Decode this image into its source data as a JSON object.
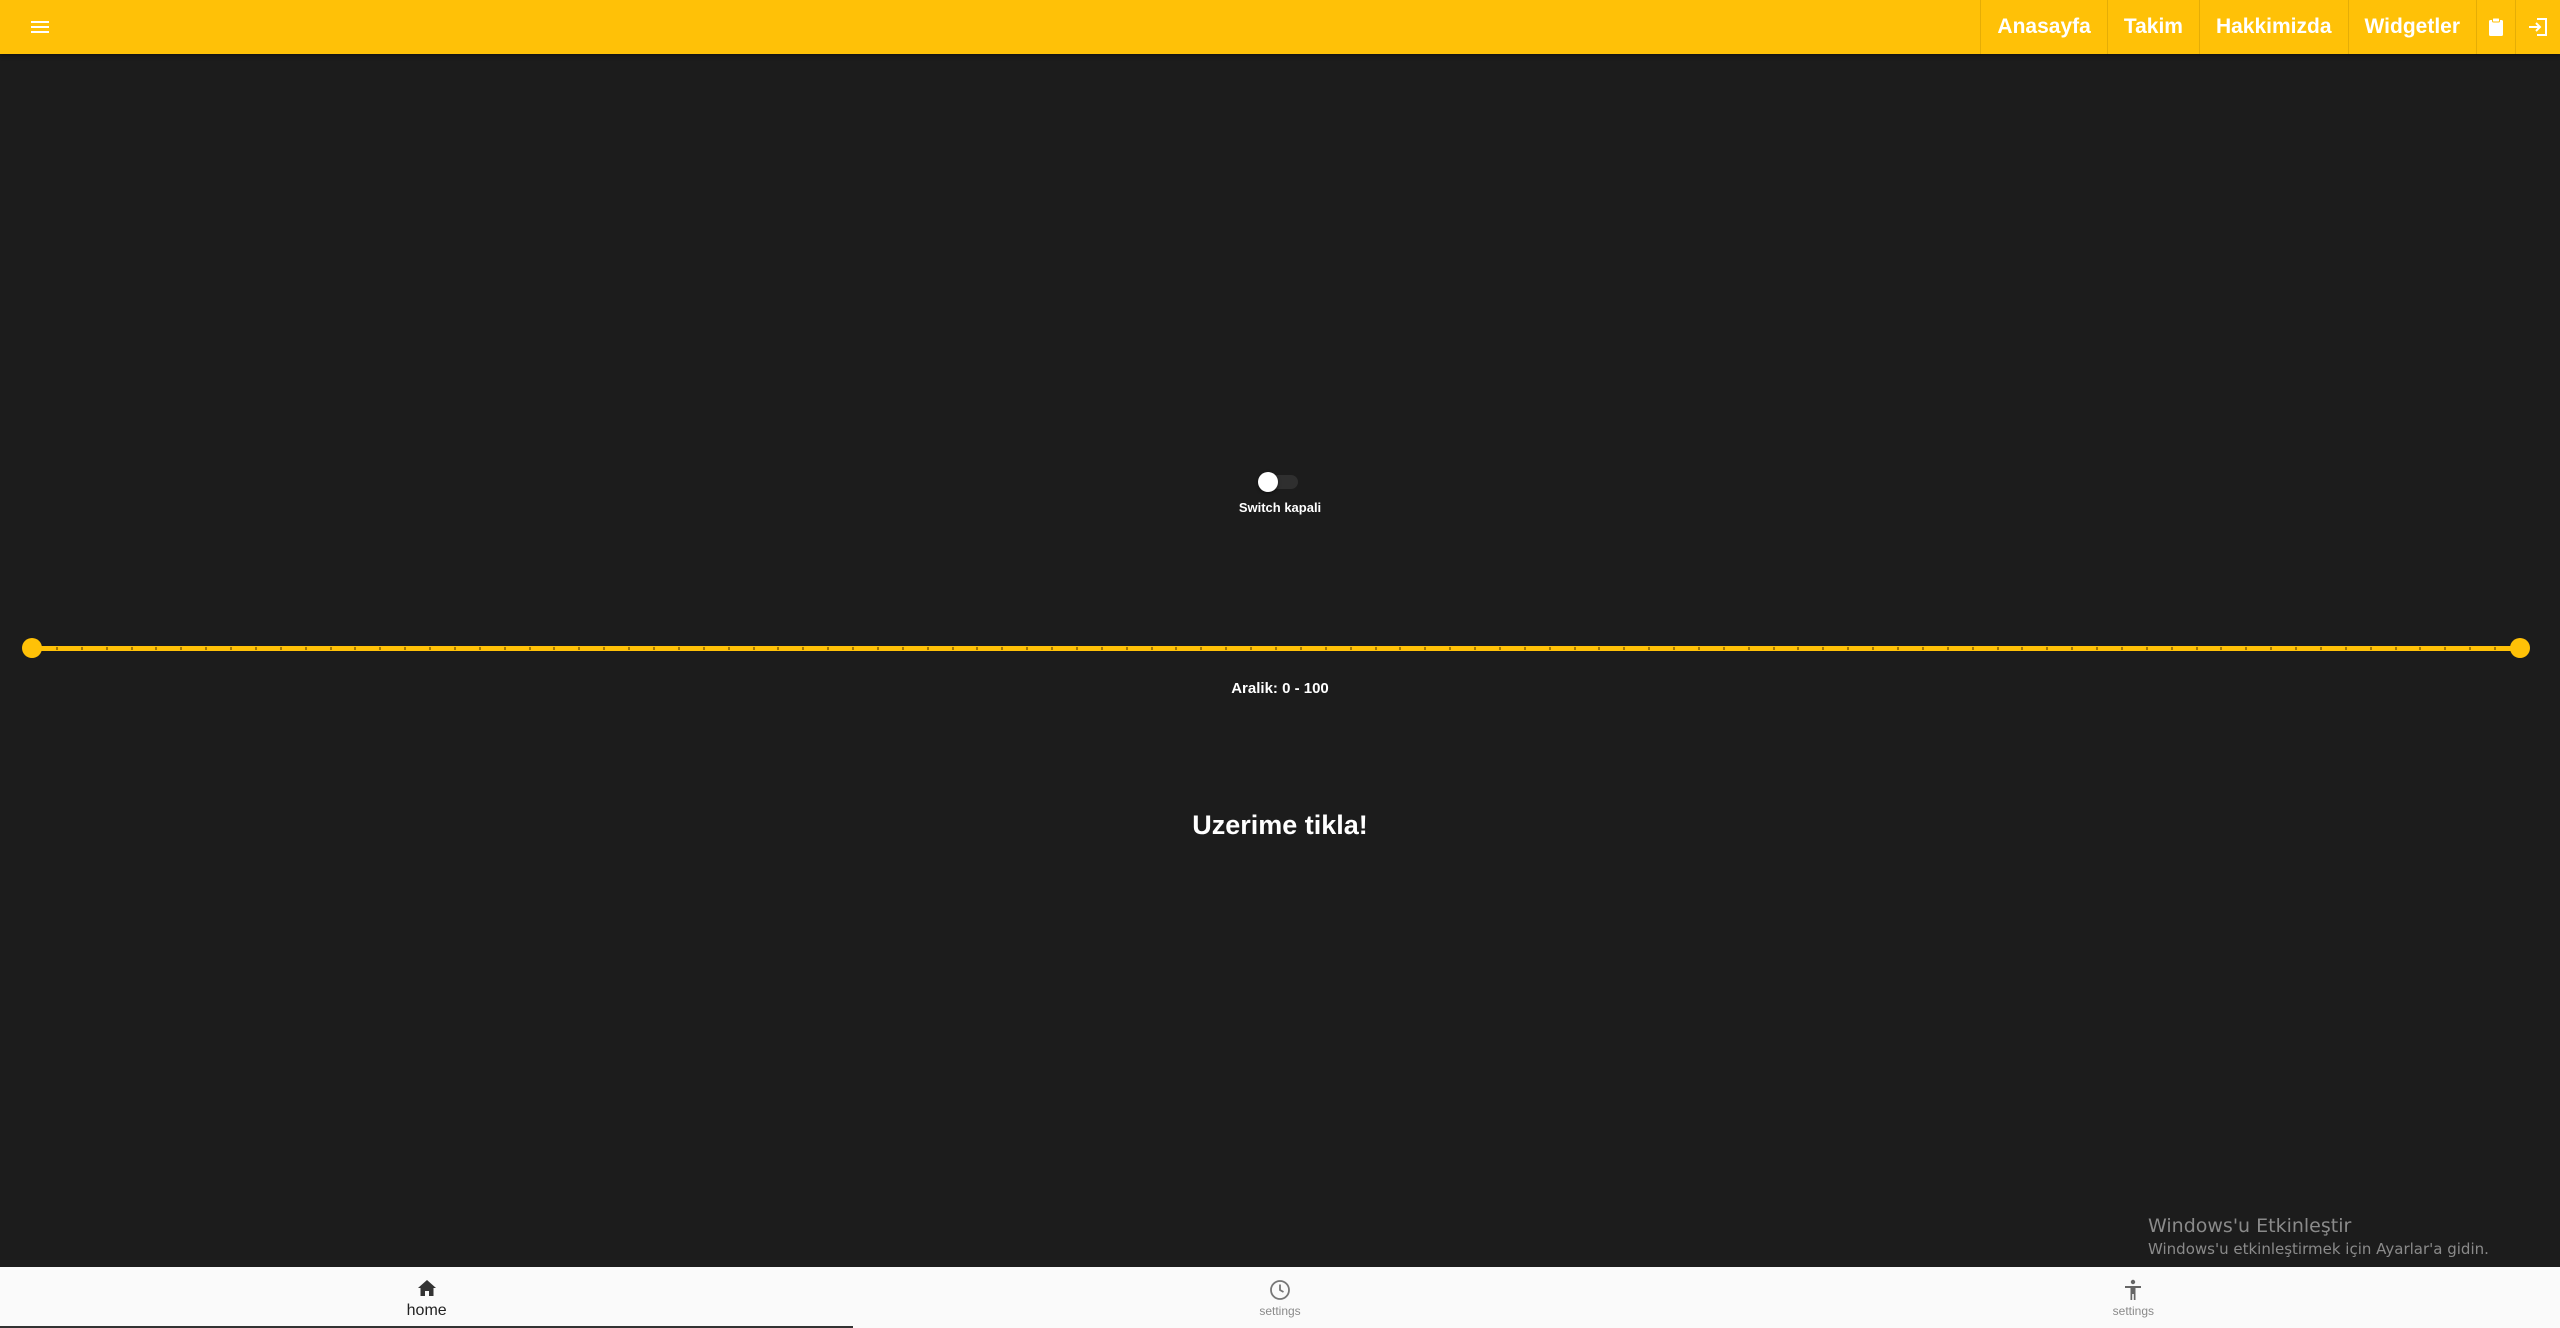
{
  "colors": {
    "accent": "#ffc107",
    "background": "#1c1c1c",
    "bottom_bar": "#fafafa"
  },
  "header": {
    "menu_icon": "hamburger-menu-icon",
    "nav": [
      {
        "label": "Anasayfa"
      },
      {
        "label": "Takim"
      },
      {
        "label": "Hakkimizda"
      },
      {
        "label": "Widgetler"
      }
    ],
    "icons": [
      "clipboard-icon",
      "login-icon"
    ]
  },
  "switch": {
    "checked": false,
    "label": "Switch kapali"
  },
  "slider": {
    "min": 0,
    "max": 100,
    "low": 0,
    "high": 100,
    "steps": 100,
    "label": "Aralik: 0 - 100"
  },
  "click_text": "Uzerime tikla!",
  "watermark": {
    "title": "Windows'u Etkinleştir",
    "subtitle": "Windows'u etkinleştirmek için Ayarlar'a gidin."
  },
  "bottom_nav": [
    {
      "label": "home",
      "icon": "home-icon",
      "active": true
    },
    {
      "label": "settings",
      "icon": "clock-icon",
      "active": false
    },
    {
      "label": "settings",
      "icon": "accessibility-icon",
      "active": false
    }
  ]
}
